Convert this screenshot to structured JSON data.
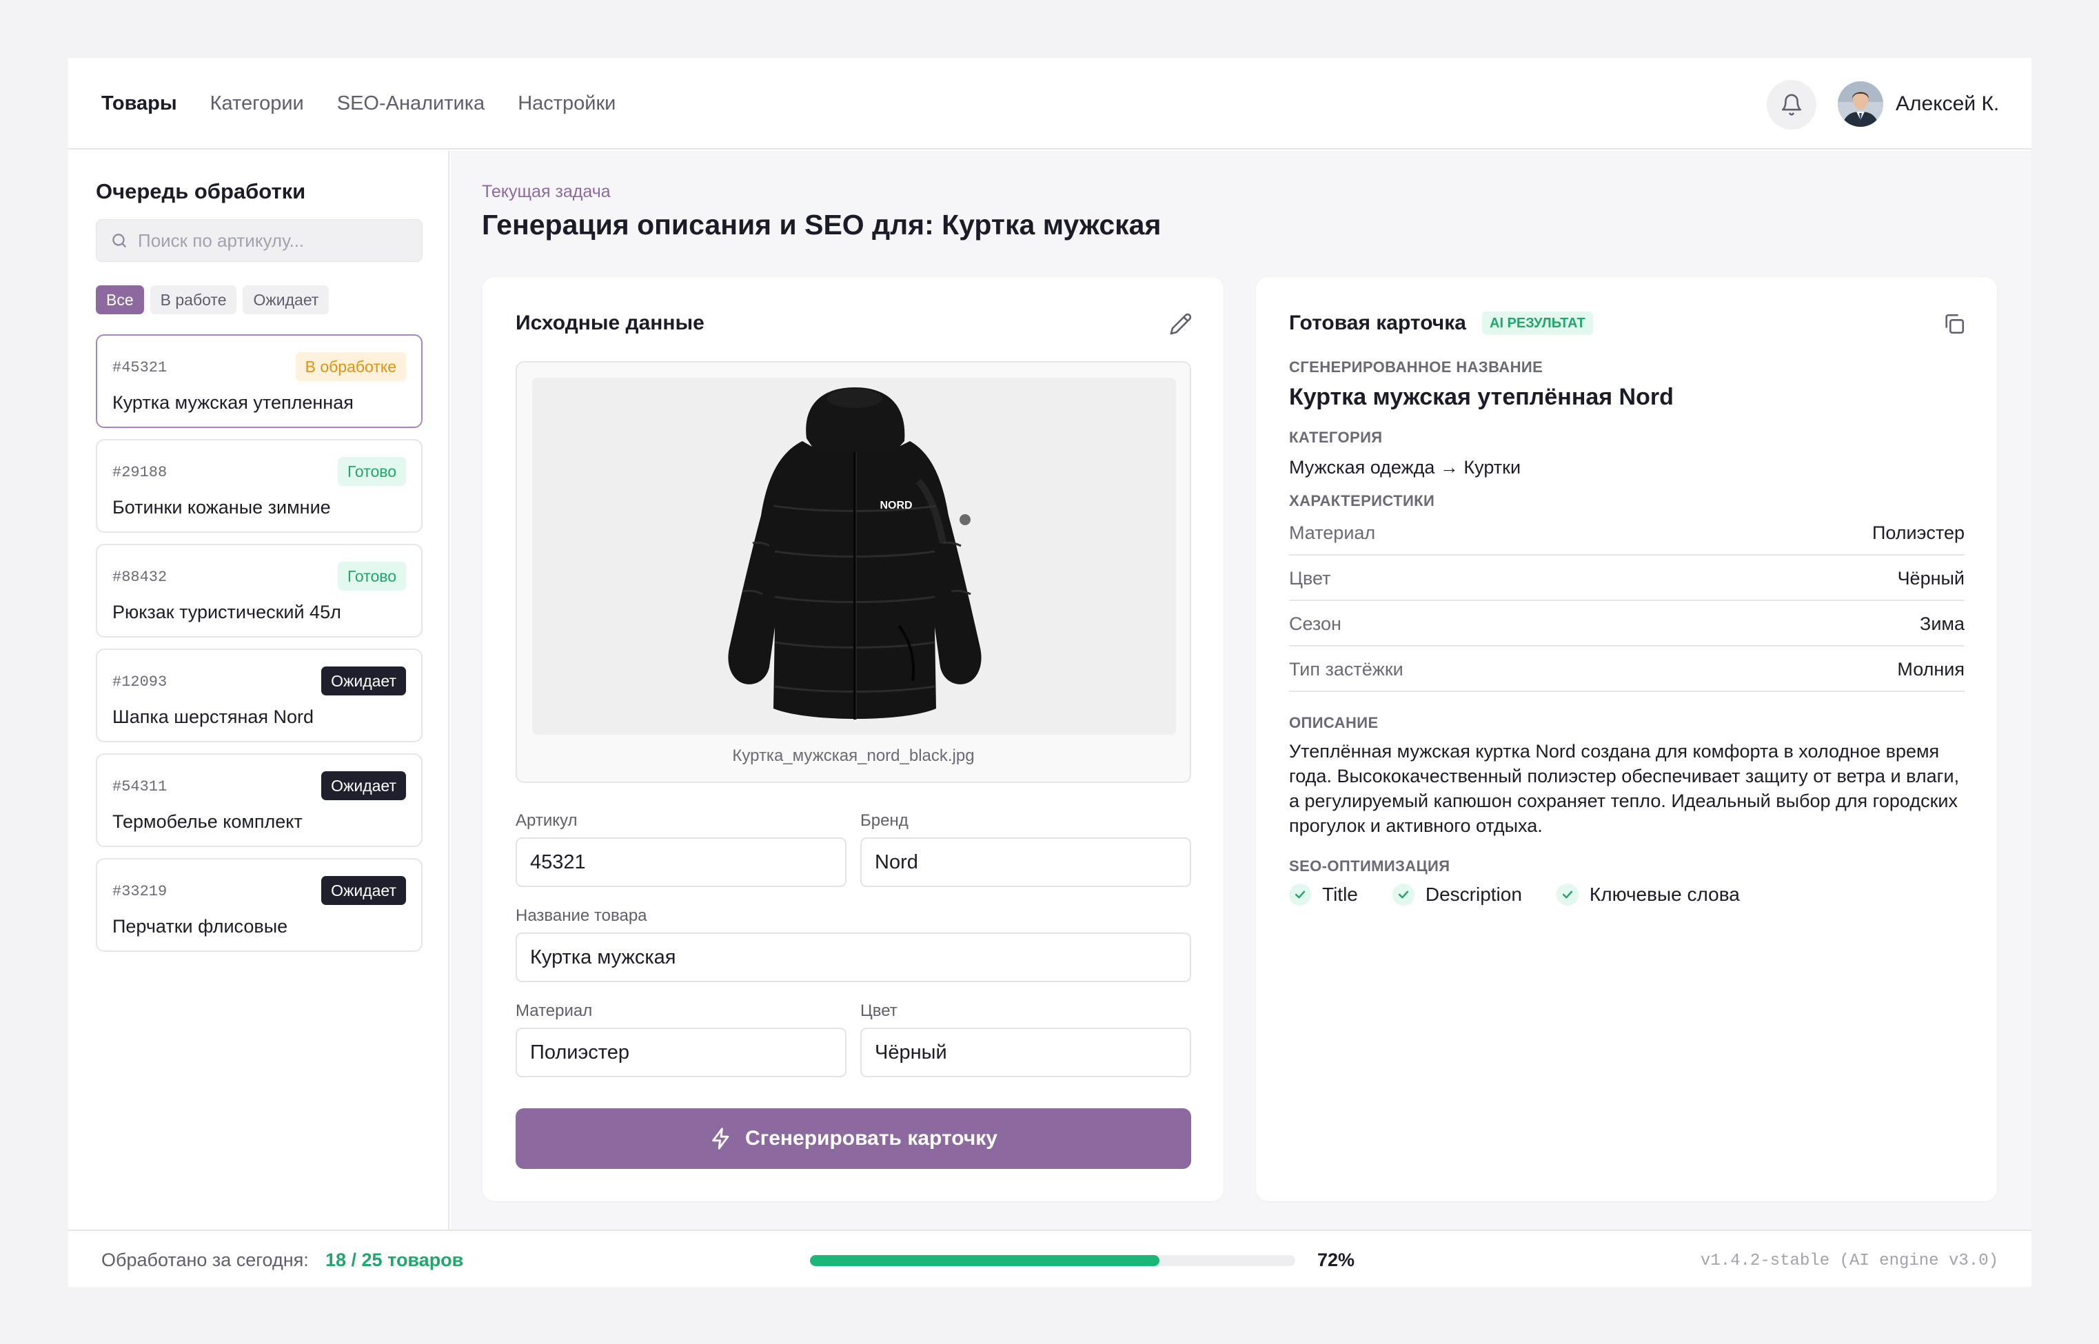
{
  "nav": {
    "items": [
      {
        "label": "Товары",
        "active": true
      },
      {
        "label": "Категории",
        "active": false
      },
      {
        "label": "SEO-Аналитика",
        "active": false
      },
      {
        "label": "Настройки",
        "active": false
      }
    ]
  },
  "header": {
    "user_name": "Алексей К.",
    "bell_icon": "bell-icon"
  },
  "sidebar": {
    "title": "Очередь обработки",
    "search_placeholder": "Поиск по артикулу...",
    "filters": [
      "Все",
      "В работе",
      "Ожидает"
    ],
    "queue": [
      {
        "id": "#45321",
        "name": "Куртка мужская утепленная",
        "status": "В обработке",
        "status_type": "processing"
      },
      {
        "id": "#29188",
        "name": "Ботинки кожаные зимние",
        "status": "Готово",
        "status_type": "done"
      },
      {
        "id": "#88432",
        "name": "Рюкзак туристический 45л",
        "status": "Готово",
        "status_type": "done"
      },
      {
        "id": "#12093",
        "name": "Шапка шерстяная Nord",
        "status": "Ожидает",
        "status_type": "waiting"
      },
      {
        "id": "#54311",
        "name": "Термобелье комплект",
        "status": "Ожидает",
        "status_type": "waiting"
      },
      {
        "id": "#33219",
        "name": "Перчатки флисовые",
        "status": "Ожидает",
        "status_type": "waiting"
      }
    ]
  },
  "main": {
    "task_label": "Текущая задача",
    "task_title": "Генерация описания и SEO для: Куртка мужская"
  },
  "source": {
    "title": "Исходные данные",
    "image_caption": "Куртка_мужская_nord_black.jpg",
    "jacket_brand_print": "NORD",
    "fields": {
      "sku_label": "Артикул",
      "sku_value": "45321",
      "brand_label": "Бренд",
      "brand_value": "Nord",
      "name_label": "Название товара",
      "name_value": "Куртка мужская",
      "material_label": "Материал",
      "material_value": "Полиэстер",
      "color_label": "Цвет",
      "color_value": "Чёрный"
    },
    "generate_button": "Сгенерировать карточку"
  },
  "result": {
    "title": "Готовая карточка",
    "badge": "AI РЕЗУЛЬТАТ",
    "gen_name_label": "СГЕНЕРИРОВАННОЕ НАЗВАНИЕ",
    "gen_name": "Куртка мужская утеплённая Nord",
    "category_label": "КАТЕГОРИЯ",
    "category": "Мужская одежда → Куртки",
    "specs_label": "ХАРАКТЕРИСТИКИ",
    "specs": [
      {
        "key": "Материал",
        "value": "Полиэстер"
      },
      {
        "key": "Цвет",
        "value": "Чёрный"
      },
      {
        "key": "Сезон",
        "value": "Зима"
      },
      {
        "key": "Тип застёжки",
        "value": "Молния"
      }
    ],
    "description_label": "ОПИСАНИЕ",
    "description": "Утеплённая мужская куртка Nord создана для комфорта в холодное время года. Высококачественный полиэстер обеспечивает защиту от ветра и влаги, а регулируемый капюшон сохраняет тепло. Идеальный выбор для городских прогулок и активного отдыха.",
    "seo_label": "SEO-ОПТИМИЗАЦИЯ",
    "seo_items": [
      "Title",
      "Description",
      "Ключевые слова"
    ]
  },
  "footer": {
    "processed_label": "Обработано за сегодня:",
    "processed_count": "18 / 25 товаров",
    "progress": 0.72,
    "progress_label": "72%",
    "version": "v1.4.2-stable (AI engine v3.0)"
  },
  "colors": {
    "accent": "#8c6a9f",
    "success": "#21a66b",
    "warning": "#e2920c",
    "dark_badge": "#1f1f2e"
  }
}
